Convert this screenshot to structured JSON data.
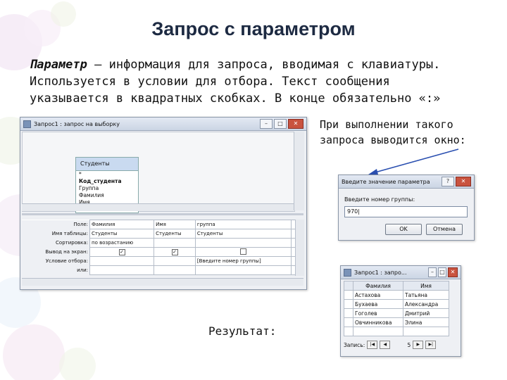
{
  "slide": {
    "title": "Запрос с параметром",
    "term": "Параметр",
    "definition": " – информация для запроса, вводимая с клавиатуры. Используется в условии для отбора. Текст сообщения указывается в квадратных скобках. В конце обязательно «:»",
    "note": "При выполнении такого запроса выводится окно:",
    "result_label": "Результат:"
  },
  "query_window": {
    "title": "Запрос1 : запрос на выборку",
    "table": {
      "name": "Студенты",
      "fields": [
        "*",
        "Код_студента",
        "Группа",
        "Фамилия",
        "Имя"
      ]
    },
    "grid": {
      "row_labels": [
        "Поле:",
        "Имя таблицы:",
        "Сортировка:",
        "Вывод на экран:",
        "Условие отбора:",
        "или:"
      ],
      "columns": [
        {
          "field": "Фамилия",
          "table": "Студенты",
          "sort": "по возрастанию",
          "show": "✓",
          "criteria": ""
        },
        {
          "field": "Имя",
          "table": "Студенты",
          "sort": "",
          "show": "✓",
          "criteria": ""
        },
        {
          "field": "группа",
          "table": "Студенты",
          "sort": "",
          "show": "",
          "criteria": "[Введите номер группы]"
        }
      ]
    }
  },
  "param_dialog": {
    "title": "Введите значение параметра",
    "prompt": "Введите номер группы:",
    "value": "970",
    "ok": "OK",
    "cancel": "Отмена"
  },
  "result_window": {
    "title": "Запрос1 : запро...",
    "headers": [
      "Фамилия",
      "Имя"
    ],
    "rows": [
      [
        "Астахова",
        "Татьяна"
      ],
      [
        "Бухаева",
        "Александра"
      ],
      [
        "Гоголев",
        "Дмитрий"
      ],
      [
        "Овчинникова",
        "Элина"
      ]
    ],
    "nav_label": "Запись:",
    "nav_count": "5"
  },
  "colors": {
    "title": "#1d2a42",
    "arrow": "#2a4fb0"
  }
}
